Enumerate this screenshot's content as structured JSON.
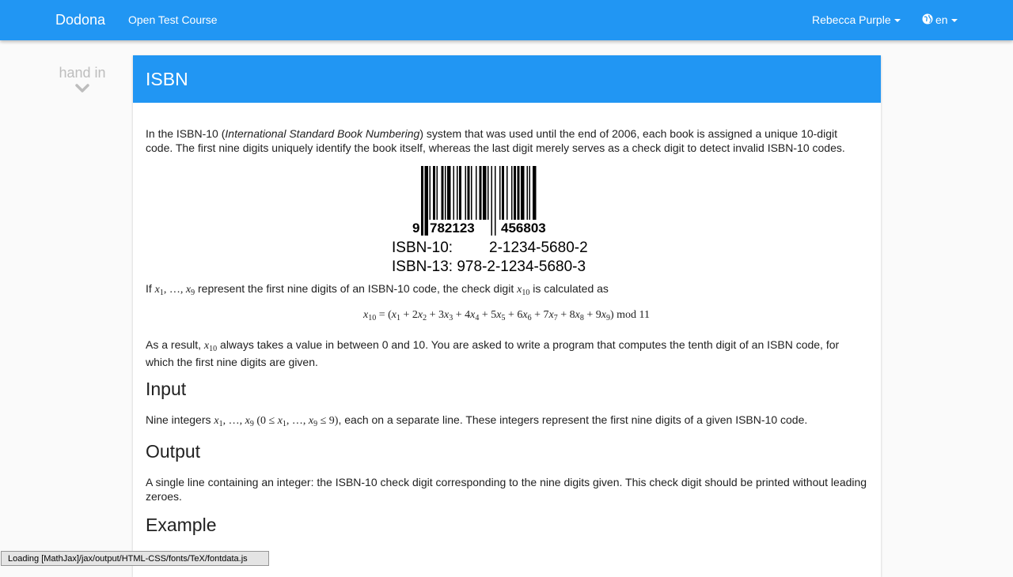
{
  "nav": {
    "brand": "Dodona",
    "course": "Open Test Course",
    "user": "Rebecca Purple",
    "lang": "en"
  },
  "side": {
    "hand_in": "hand in"
  },
  "card": {
    "title": "ISBN",
    "intro_1": "In the ISBN-10 (",
    "intro_italic": "International Standard Book Numbering",
    "intro_2": ") system that was used until the end of 2006, each book is assigned a unique 10-digit code. The first nine digits uniquely identify the book itself, whereas the last digit merely serves as a check digit to detect invalid ISBN-10 codes.",
    "barcode": {
      "left_digit": "9",
      "group1": "782123",
      "group2": "456803",
      "isbn10_label": "ISBN-10:",
      "isbn10_value": "2-1234-5680-2",
      "isbn13_line": "ISBN-13: 978-2-1234-5680-3"
    },
    "check_1": "If ",
    "check_2": " represent the first nine digits of an ISBN-10 code, the check digit ",
    "check_3": " is calculated as",
    "formula_tail": "mod 11",
    "result_1": "As a result, ",
    "result_2": " always takes a value in between 0 and 10. You are asked to write a program that computes the tenth digit of an ISBN code, for which the first nine digits are given.",
    "input_heading": "Input",
    "input_1": "Nine integers ",
    "input_2": ", each on a separate line. These integers represent the first nine digits of a given ISBN-10 code.",
    "output_heading": "Output",
    "output_text": "A single line containing an integer: the ISBN-10 check digit corresponding to the nine digits given. This check digit should be printed without leading zeroes.",
    "example_heading": "Example"
  },
  "status_bar": "Loading [MathJax]/jax/output/HTML-CSS/fonts/TeX/fontdata.js",
  "colors": {
    "primary": "#2196f3",
    "muted": "#bdbdbd"
  },
  "icons": {
    "globe": "globe-icon",
    "chevron": "chevron-down-icon",
    "caret": "caret-down-icon"
  }
}
